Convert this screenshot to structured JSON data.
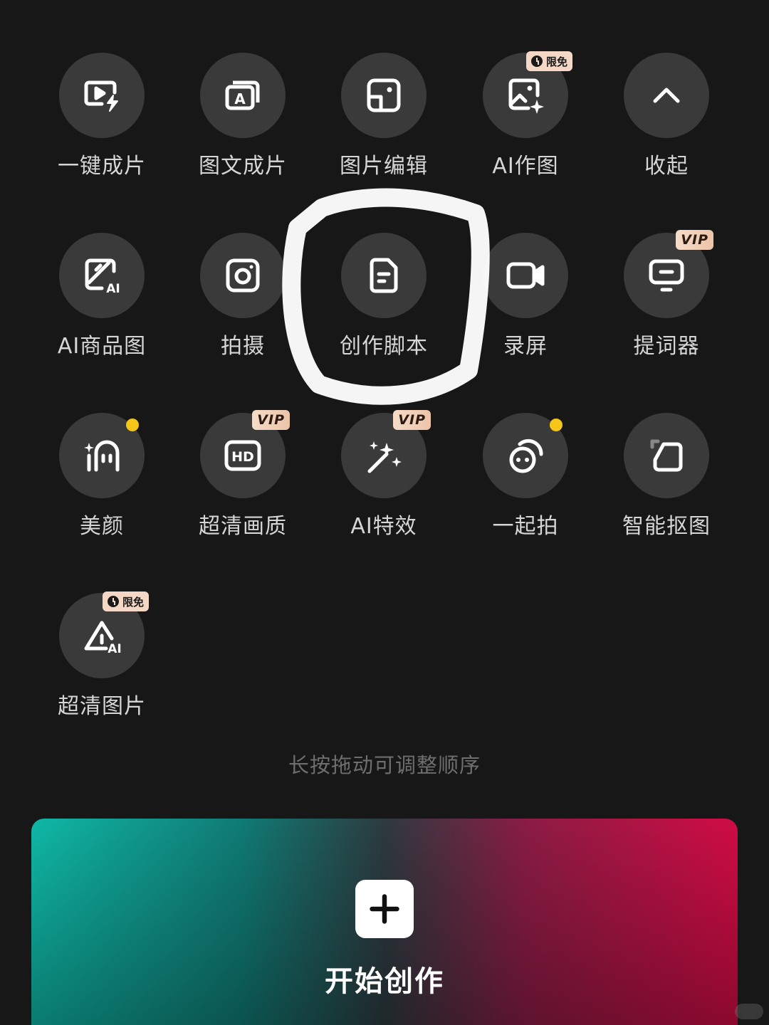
{
  "tools": [
    {
      "label": "一键成片",
      "icon": "one-click-video-icon"
    },
    {
      "label": "图文成片",
      "icon": "text-to-video-icon"
    },
    {
      "label": "图片编辑",
      "icon": "image-edit-icon"
    },
    {
      "label": "AI作图",
      "icon": "ai-image-icon",
      "badge": "限免"
    },
    {
      "label": "收起",
      "icon": "chevron-up-icon"
    },
    {
      "label": "AI商品图",
      "icon": "ai-product-icon"
    },
    {
      "label": "拍摄",
      "icon": "camera-icon"
    },
    {
      "label": "创作脚本",
      "icon": "script-icon"
    },
    {
      "label": "录屏",
      "icon": "screen-record-icon"
    },
    {
      "label": "提词器",
      "icon": "teleprompter-icon",
      "badge": "VIP"
    },
    {
      "label": "美颜",
      "icon": "beauty-icon",
      "dot": true
    },
    {
      "label": "超清画质",
      "icon": "hd-icon",
      "badge": "VIP"
    },
    {
      "label": "AI特效",
      "icon": "magic-wand-icon",
      "badge": "VIP"
    },
    {
      "label": "一起拍",
      "icon": "shoot-together-icon",
      "dot": true
    },
    {
      "label": "智能抠图",
      "icon": "cutout-icon"
    },
    {
      "label": "超清图片",
      "icon": "ai-enhance-image-icon",
      "badge": "限免"
    }
  ],
  "hint_text": "长按拖动可调整顺序",
  "start_button": {
    "label": "开始创作",
    "icon": "plus-icon"
  },
  "colors": {
    "background": "#171717",
    "circle": "#3a3a3a",
    "dot": "#f5c518",
    "gradient_left": "#0fb8a6",
    "gradient_right": "#d10c45"
  }
}
